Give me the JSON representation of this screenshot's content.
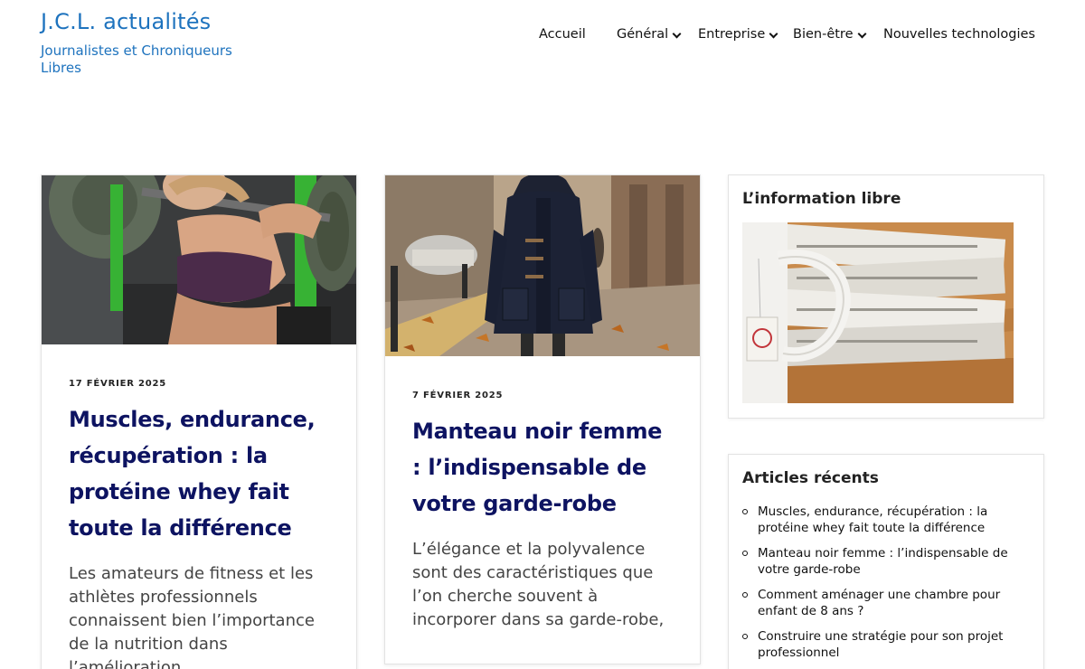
{
  "site": {
    "title": "J.C.L. actualités",
    "description": "Journalistes et Chroniqueurs Libres"
  },
  "nav": {
    "items": [
      {
        "label": "Accueil",
        "has_submenu": false
      },
      {
        "label": "Général",
        "has_submenu": true
      },
      {
        "label": "Entreprise",
        "has_submenu": true
      },
      {
        "label": "Bien-être",
        "has_submenu": true
      },
      {
        "label": "Nouvelles technologies",
        "has_submenu": false
      }
    ]
  },
  "posts": [
    {
      "date": "17 FÉVRIER 2025",
      "title": "Muscles, endurance, récupération : la protéine whey fait toute la différence",
      "excerpt": "Les amateurs de fitness et les athlètes professionnels connaissent bien l’importance de la nutrition dans l’amélioration",
      "image": "woman-weightlifting-photo"
    },
    {
      "date": "7 FÉVRIER 2025",
      "title": "Manteau noir femme : l’indispensable de votre garde-robe",
      "excerpt": "L’élégance et la polyvalence sont des caractéristiques que l’on cherche souvent à incorporer dans sa garde-robe,",
      "image": "black-duffle-coat-photo"
    }
  ],
  "sidebar": {
    "info_widget": {
      "title": "L’information libre",
      "image": "newspapers-and-tea-photo"
    },
    "recent_widget": {
      "title": "Articles récents",
      "items": [
        "Muscles, endurance, récupération : la protéine whey fait toute la différence",
        "Manteau noir femme : l’indispensable de votre garde-robe",
        "Comment aménager une chambre pour enfant de 8 ans  ?",
        "Construire une stratégie pour son projet professionnel"
      ]
    }
  },
  "colors": {
    "brand": "#1e73be",
    "post_title": "#0d1361"
  }
}
